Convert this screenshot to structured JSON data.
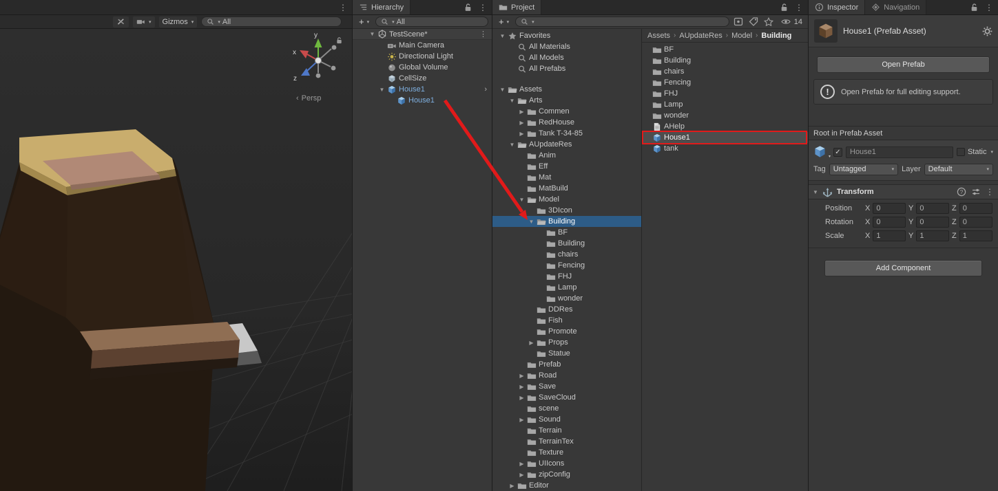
{
  "colors": {
    "selection_blue": "#2D5C87",
    "selection_gray": "#4D4D4D",
    "prefab_text": "#7FB0E0",
    "annotation_red": "#E11A1A"
  },
  "scene": {
    "toolbar": {
      "gizmos_label": "Gizmos",
      "search_value": "All"
    },
    "gizmo": {
      "x": "x",
      "y": "y",
      "z": "z",
      "persp_label": "Persp"
    }
  },
  "hierarchy": {
    "tab": "Hierarchy",
    "toolbar": {
      "add": "+",
      "search_value": "All"
    },
    "rows": [
      {
        "depth": 0,
        "arrow": "open",
        "icon": "scene",
        "label": "TestScene*",
        "header": true,
        "trailing": "kebab"
      },
      {
        "depth": 1,
        "icon": "camera",
        "label": "Main Camera"
      },
      {
        "depth": 1,
        "icon": "light",
        "label": "Directional Light"
      },
      {
        "depth": 1,
        "icon": "volume",
        "label": "Global Volume"
      },
      {
        "depth": 1,
        "icon": "gameobject",
        "label": "CellSize"
      },
      {
        "depth": 1,
        "arrow": "open",
        "icon": "prefab",
        "label": "House1",
        "blue": true,
        "trailing": "chevron"
      },
      {
        "depth": 2,
        "icon": "prefab",
        "label": "House1",
        "blue": true
      }
    ]
  },
  "project": {
    "tab": "Project",
    "toolbar": {
      "add": "+",
      "search_value": "",
      "hidden_count": "14"
    },
    "breadcrumbs": [
      "Assets",
      "AUpdateRes",
      "Model",
      "Building"
    ],
    "tree_rows": [
      {
        "depth": 0,
        "arrow": "open",
        "icon": "star",
        "label": "Favorites"
      },
      {
        "depth": 1,
        "icon": "search",
        "label": "All Materials"
      },
      {
        "depth": 1,
        "icon": "search",
        "label": "All Models"
      },
      {
        "depth": 1,
        "icon": "search",
        "label": "All Prefabs"
      },
      {
        "spacer": 14
      },
      {
        "depth": 0,
        "arrow": "open",
        "icon": "folder-open",
        "label": "Assets"
      },
      {
        "depth": 1,
        "arrow": "open",
        "icon": "folder-open",
        "label": "Arts"
      },
      {
        "depth": 2,
        "arrow": "closed",
        "icon": "folder",
        "label": "Commen"
      },
      {
        "depth": 2,
        "arrow": "closed",
        "icon": "folder",
        "label": "RedHouse"
      },
      {
        "depth": 2,
        "arrow": "closed",
        "icon": "folder",
        "label": "Tank T-34-85"
      },
      {
        "depth": 1,
        "arrow": "open",
        "icon": "folder-open",
        "label": "AUpdateRes"
      },
      {
        "depth": 2,
        "icon": "folder",
        "label": "Anim"
      },
      {
        "depth": 2,
        "icon": "folder",
        "label": "Eff"
      },
      {
        "depth": 2,
        "icon": "folder",
        "label": "Mat"
      },
      {
        "depth": 2,
        "icon": "folder",
        "label": "MatBuild"
      },
      {
        "depth": 2,
        "arrow": "open",
        "icon": "folder-open",
        "label": "Model"
      },
      {
        "depth": 3,
        "icon": "folder",
        "label": "3DIcon"
      },
      {
        "depth": 3,
        "arrow": "open",
        "icon": "folder-open",
        "label": "Building",
        "selected": true
      },
      {
        "depth": 4,
        "icon": "folder",
        "label": "BF"
      },
      {
        "depth": 4,
        "icon": "folder",
        "label": "Building"
      },
      {
        "depth": 4,
        "icon": "folder",
        "label": "chairs"
      },
      {
        "depth": 4,
        "icon": "folder",
        "label": "Fencing"
      },
      {
        "depth": 4,
        "icon": "folder",
        "label": "FHJ"
      },
      {
        "depth": 4,
        "icon": "folder",
        "label": "Lamp"
      },
      {
        "depth": 4,
        "icon": "folder",
        "label": "wonder"
      },
      {
        "depth": 3,
        "icon": "folder",
        "label": "DDRes"
      },
      {
        "depth": 3,
        "icon": "folder",
        "label": "Fish"
      },
      {
        "depth": 3,
        "icon": "folder",
        "label": "Promote"
      },
      {
        "depth": 3,
        "arrow": "closed",
        "icon": "folder",
        "label": "Props"
      },
      {
        "depth": 3,
        "icon": "folder",
        "label": "Statue"
      },
      {
        "depth": 2,
        "icon": "folder",
        "label": "Prefab"
      },
      {
        "depth": 2,
        "arrow": "closed",
        "icon": "folder",
        "label": "Road"
      },
      {
        "depth": 2,
        "arrow": "closed",
        "icon": "folder",
        "label": "Save"
      },
      {
        "depth": 2,
        "arrow": "closed",
        "icon": "folder",
        "label": "SaveCloud"
      },
      {
        "depth": 2,
        "icon": "folder",
        "label": "scene"
      },
      {
        "depth": 2,
        "arrow": "closed",
        "icon": "folder",
        "label": "Sound"
      },
      {
        "depth": 2,
        "icon": "folder",
        "label": "Terrain"
      },
      {
        "depth": 2,
        "icon": "folder",
        "label": "TerrainTex"
      },
      {
        "depth": 2,
        "icon": "folder",
        "label": "Texture"
      },
      {
        "depth": 2,
        "arrow": "closed",
        "icon": "folder",
        "label": "UIIcons"
      },
      {
        "depth": 2,
        "arrow": "closed",
        "icon": "folder",
        "label": "zipConfig"
      },
      {
        "depth": 1,
        "arrow": "closed",
        "icon": "folder",
        "label": "Editor"
      }
    ],
    "content_items": [
      {
        "icon": "folder",
        "label": "BF"
      },
      {
        "icon": "folder",
        "label": "Building"
      },
      {
        "icon": "folder",
        "label": "chairs"
      },
      {
        "icon": "folder",
        "label": "Fencing"
      },
      {
        "icon": "folder",
        "label": "FHJ"
      },
      {
        "icon": "folder",
        "label": "Lamp"
      },
      {
        "icon": "folder",
        "label": "wonder"
      },
      {
        "icon": "text",
        "label": "AHelp"
      },
      {
        "icon": "prefab",
        "label": "House1",
        "selected": true
      },
      {
        "icon": "prefab",
        "label": "tank"
      }
    ]
  },
  "inspector": {
    "tabs": [
      "Inspector",
      "Navigation"
    ],
    "title": "House1 (Prefab Asset)",
    "open_prefab_label": "Open Prefab",
    "info_text": "Open Prefab for full editing support.",
    "root_label": "Root in Prefab Asset",
    "gameobject": {
      "name": "House1",
      "static_label": "Static",
      "tag_label": "Tag",
      "tag_value": "Untagged",
      "layer_label": "Layer",
      "layer_value": "Default"
    },
    "transform": {
      "title": "Transform",
      "axis_labels": [
        "X",
        "Y",
        "Z"
      ],
      "rows": [
        {
          "label": "Position",
          "x": "0",
          "y": "0",
          "z": "0"
        },
        {
          "label": "Rotation",
          "x": "0",
          "y": "0",
          "z": "0"
        },
        {
          "label": "Scale",
          "x": "1",
          "y": "1",
          "z": "1"
        }
      ]
    },
    "add_component_label": "Add Component"
  }
}
